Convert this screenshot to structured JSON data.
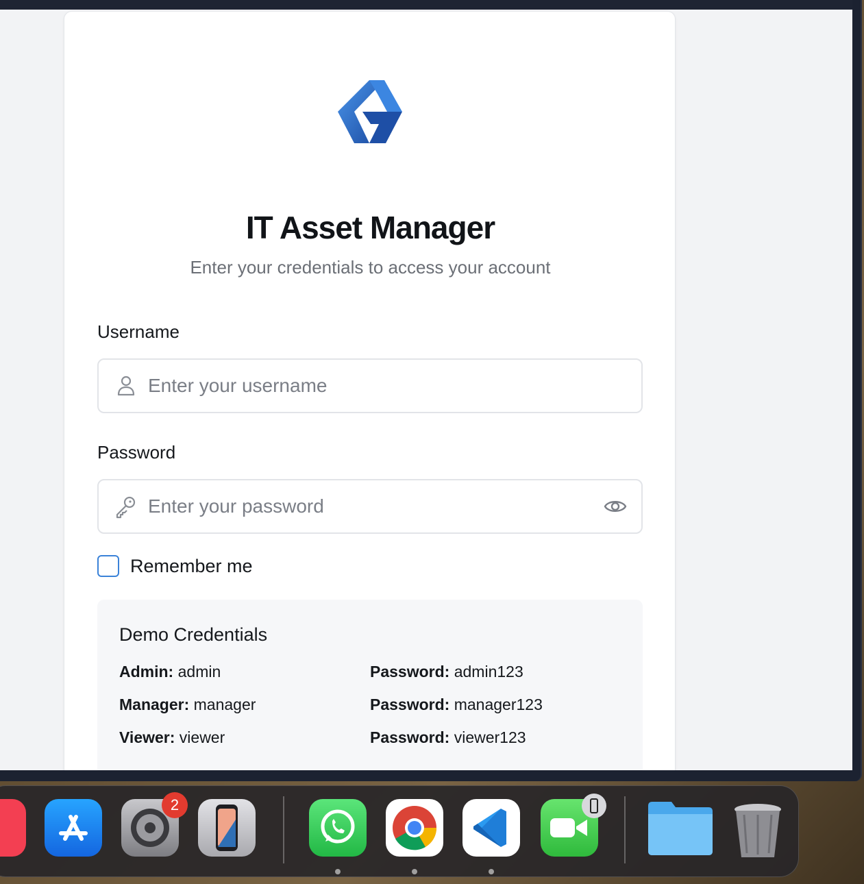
{
  "app": {
    "title": "IT Asset Manager",
    "subtitle": "Enter your credentials to access your account"
  },
  "form": {
    "username_label": "Username",
    "username_placeholder": "Enter your username",
    "username_value": "",
    "password_label": "Password",
    "password_placeholder": "Enter your password",
    "password_value": "",
    "remember_label": "Remember me",
    "remember_checked": false
  },
  "demo": {
    "title": "Demo Credentials",
    "rows": [
      {
        "role": "Admin:",
        "user": "admin",
        "pw_label": "Password:",
        "pw": "admin123"
      },
      {
        "role": "Manager:",
        "user": "manager",
        "pw_label": "Password:",
        "pw": "manager123"
      },
      {
        "role": "Viewer:",
        "user": "viewer",
        "pw_label": "Password:",
        "pw": "viewer123"
      }
    ]
  },
  "dock": {
    "items": [
      {
        "name": "music-app-icon",
        "color": "#f33f52"
      },
      {
        "name": "app-store-icon",
        "color": "#1a8cf7"
      },
      {
        "name": "system-settings-icon",
        "color": "#8e8e93"
      },
      {
        "name": "iphone-mirroring-icon",
        "color": "#bfbfc4"
      },
      {
        "name": "whatsapp-icon",
        "color": "#2fd15a"
      },
      {
        "name": "chrome-icon",
        "color": "#ffffff"
      },
      {
        "name": "vscode-icon",
        "color": "#ffffff"
      },
      {
        "name": "facetime-icon",
        "color": "#3ecf4f"
      },
      {
        "name": "folder-icon",
        "color": "#5fb8f3"
      },
      {
        "name": "trash-icon",
        "color": "#9a9a9e"
      }
    ],
    "settings_badge": "2"
  },
  "colors": {
    "accent": "#3a82d8",
    "logo_dark": "#1d4fa8",
    "logo_light": "#3b86e3"
  }
}
